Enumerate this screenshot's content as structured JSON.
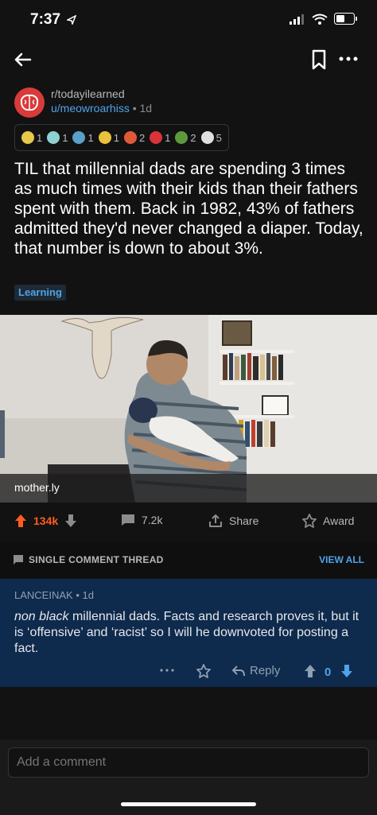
{
  "status": {
    "time": "7:37"
  },
  "post": {
    "subreddit": "r/todayilearned",
    "author": "u/meowroarhiss",
    "age": "1d",
    "awards": [
      {
        "icon": "gold-hands-award",
        "count": "1",
        "color": "#e6c84a"
      },
      {
        "icon": "diamond-award",
        "count": "1",
        "color": "#8fd0d0"
      },
      {
        "icon": "globe-award",
        "count": "1",
        "color": "#5aa0c8"
      },
      {
        "icon": "star-award",
        "count": "1",
        "color": "#e8c23a"
      },
      {
        "icon": "2020-glasses-award",
        "count": "2",
        "color": "#e05a3a"
      },
      {
        "icon": "gift-award",
        "count": "1",
        "color": "#d8343a"
      },
      {
        "icon": "trophy-award",
        "count": "2",
        "color": "#5c9a3c"
      },
      {
        "icon": "silver-award",
        "count": "5",
        "color": "#e0e0e0"
      }
    ],
    "title": "TIL that millennial dads are spending 3 times as much times with their kids than their fathers spent with them. Back in 1982, 43% of fathers admitted they'd never changed a diaper. Today, that number is down to about 3%.",
    "flair": "Learning",
    "link_domain": "mother.ly",
    "score": "134k",
    "comments_count": "7.2k",
    "share_label": "Share",
    "award_label": "Award"
  },
  "thread": {
    "label": "SINGLE COMMENT THREAD",
    "view_all": "VIEW ALL"
  },
  "comment": {
    "author": "LANCEINAK",
    "age": "1d",
    "body_italic": "non black",
    "body_rest": " millennial dads.  Facts and research proves it, but it is ‘offensive’ and ‘racist’ so I will he downvoted for posting a fact.",
    "reply_label": "Reply",
    "score": "0"
  },
  "composer": {
    "placeholder": "Add a comment"
  },
  "colors": {
    "accent_blue": "#4fa3e8",
    "upvote_orange": "#ff5c1f",
    "comment_bg": "#0e2a4d"
  }
}
